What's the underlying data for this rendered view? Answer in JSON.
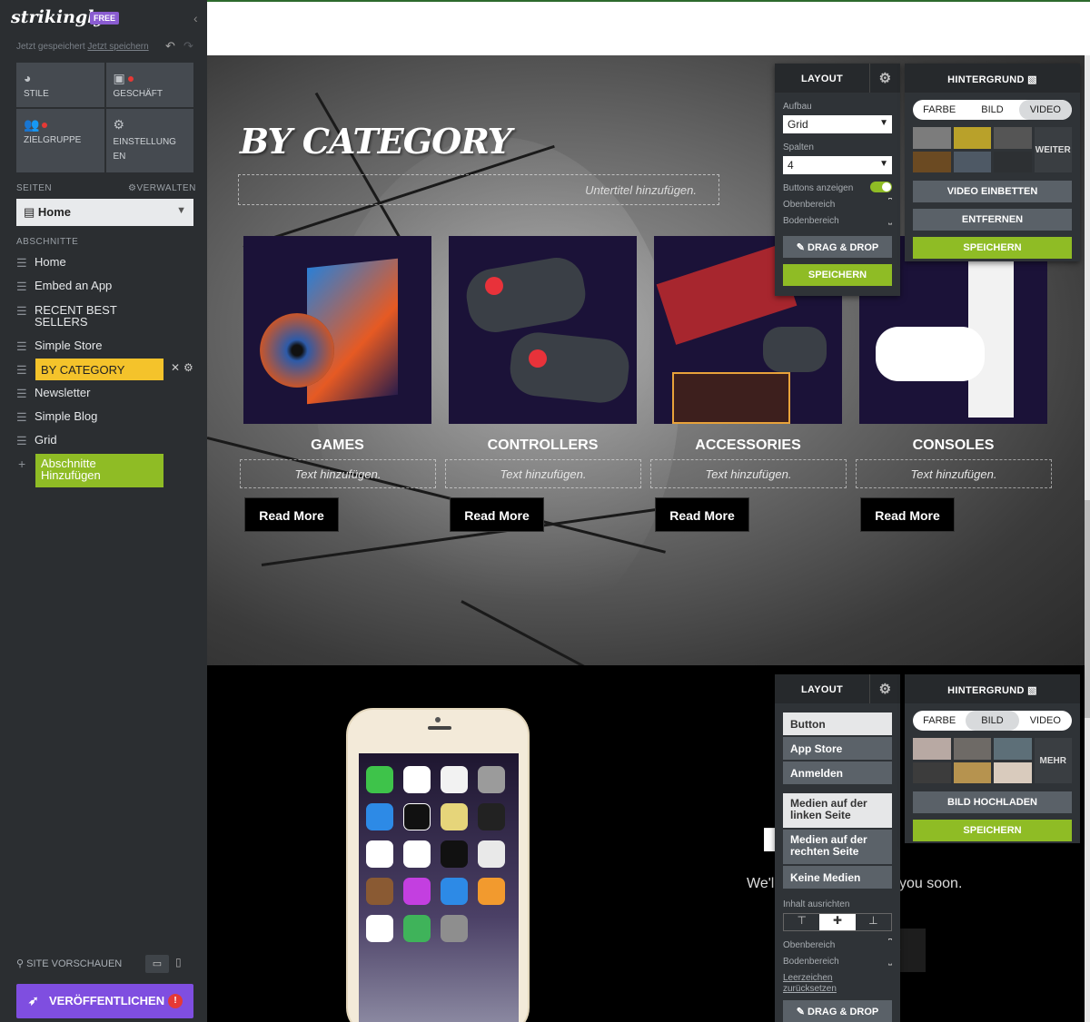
{
  "sidebar": {
    "logo": "strikingly",
    "plan_badge": "FREE",
    "saved_text": "Jetzt gespeichert",
    "save_now": "Jetzt speichern",
    "tiles": [
      {
        "label": "STILE",
        "icon": "palette-icon"
      },
      {
        "label": "GESCHÄFT",
        "icon": "shopping-bag-icon"
      },
      {
        "label": "ZIELGRUPPE",
        "icon": "people-icon"
      },
      {
        "label": "EINSTELLUNG EN",
        "icon": "gear-icon"
      }
    ],
    "pages_label": "SEITEN",
    "manage_label": "VERWALTEN",
    "current_page": "Home",
    "sections_label": "ABSCHNITTE",
    "sections": [
      "Home",
      "Embed an App",
      "RECENT BEST SELLERS",
      "Simple Store",
      "BY CATEGORY",
      "Newsletter",
      "Simple Blog",
      "Grid"
    ],
    "add_section": "Abschnitte Hinzufügen",
    "preview_label": "SITE VORSCHAUEN",
    "publish_label": "VERÖFFENTLICHEN",
    "publish_badge": "!",
    "accent_publish": "#7f4ee0",
    "accent_active": "#f4c32b",
    "accent_add": "#8fbc25"
  },
  "hero": {
    "title": "BY CATEGORY",
    "subtitle_placeholder": "Untertitel hinzufügen.",
    "cards": [
      {
        "heading": "GAMES",
        "text": "Text hinzufügen.",
        "button": "Read More"
      },
      {
        "heading": "CONTROLLERS",
        "text": "Text hinzufügen.",
        "button": "Read More"
      },
      {
        "heading": "ACCESSORIES",
        "text": "Text hinzufügen.",
        "button": "Read More"
      },
      {
        "heading": "CONSOLES",
        "text": "Text hinzufügen.",
        "button": "Read More"
      }
    ]
  },
  "layout_panel_1": {
    "header": "LAYOUT",
    "aufbau_label": "Aufbau",
    "aufbau_value": "Grid",
    "spalten_label": "Spalten",
    "spalten_value": "4",
    "buttons_label": "Buttons anzeigen",
    "buttons_on": true,
    "oben_label": "Obenbereich",
    "boden_label": "Bodenbereich",
    "drag_label": "DRAG & DROP",
    "save_label": "SPEICHERN"
  },
  "bg_panel_1": {
    "header": "HINTERGRUND",
    "tabs": [
      "FARBE",
      "BILD",
      "VIDEO"
    ],
    "active_tab": "VIDEO",
    "more_label": "WEITER",
    "embed_label": "VIDEO EINBETTEN",
    "remove_label": "ENTFERNEN",
    "save_label": "SPEICHERN"
  },
  "layout_panel_2": {
    "header": "LAYOUT",
    "buttons": [
      "Button",
      "App Store",
      "Anmelden"
    ],
    "media": [
      "Medien auf der linken Seite",
      "Medien auf der rechten Seite",
      "Keine Medien"
    ],
    "align_label": "Inhalt ausrichten",
    "oben_label": "Obenbereich",
    "boden_label": "Bodenbereich",
    "reset_label": "Leerzeichen zurücksetzen",
    "drag_label": "DRAG & DROP"
  },
  "bg_panel_2": {
    "header": "HINTERGRUND",
    "tabs": [
      "FARBE",
      "BILD",
      "VIDEO"
    ],
    "active_tab": "BILD",
    "more_label": "MEHR",
    "upload_label": "BILD HOCHLADEN",
    "save_label": "SPEICHERN"
  },
  "section2": {
    "text_left": "We'l",
    "text_right": "you soon."
  }
}
